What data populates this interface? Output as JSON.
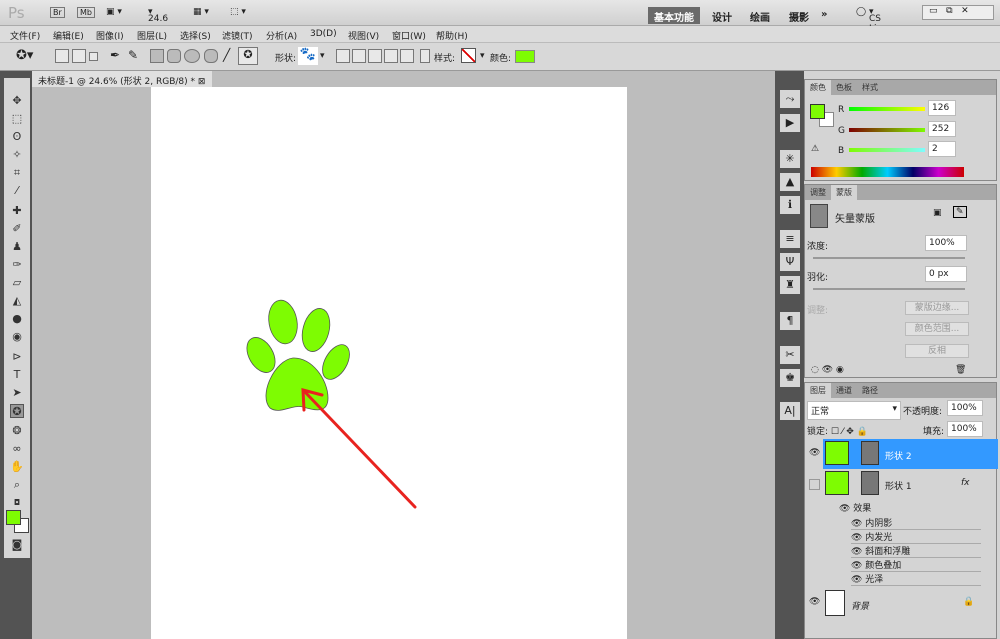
{
  "titlebar": {
    "logo": "Ps",
    "br": "Br",
    "mb": "Mb",
    "zoom": "24.6",
    "workspaces": [
      "基本功能",
      "设计",
      "绘画",
      "摄影"
    ],
    "more": "»",
    "cslive": "CS Live"
  },
  "menu": [
    "文件(F)",
    "编辑(E)",
    "图像(I)",
    "图层(L)",
    "选择(S)",
    "滤镜(T)",
    "分析(A)",
    "3D(D)",
    "视图(V)",
    "窗口(W)",
    "帮助(H)"
  ],
  "options": {
    "shape_label": "形状:",
    "style_label": "样式:",
    "color_label": "颜色:",
    "color": "#7efc02"
  },
  "document": {
    "tab": "未标题-1 @ 24.6% (形状 2, RGB/8) *"
  },
  "colors": {
    "fg": "#7efc02",
    "accent": "#3399ff",
    "arrow": "#e8231f"
  },
  "color_panel": {
    "tabs": [
      "颜色",
      "色板",
      "样式"
    ],
    "r_label": "R",
    "g_label": "G",
    "b_label": "B",
    "r": "126",
    "g": "252",
    "b": "2"
  },
  "mask_panel": {
    "tabs": [
      "调整",
      "蒙版"
    ],
    "title": "矢量蒙版",
    "density_label": "浓度:",
    "density": "100%",
    "density_frac": 1.0,
    "feather_label": "羽化:",
    "feather": "0 px",
    "feather_frac": 0,
    "refine_label": "调整:",
    "btn_edge": "蒙版边缘...",
    "btn_range": "颜色范围...",
    "btn_invert": "反相"
  },
  "layers_panel": {
    "tabs": [
      "图层",
      "通道",
      "路径"
    ],
    "blend": "正常",
    "opacity_label": "不透明度:",
    "opacity": "100%",
    "lock_label": "锁定:",
    "fill_label": "填充:",
    "fill": "100%",
    "layers": [
      {
        "name": "形状 2"
      },
      {
        "name": "形状 1",
        "fx": "fx"
      },
      {
        "name": "背景"
      }
    ],
    "effects_label": "效果",
    "effects": [
      "内阴影",
      "内发光",
      "斜面和浮雕",
      "颜色叠加",
      "光泽"
    ]
  }
}
